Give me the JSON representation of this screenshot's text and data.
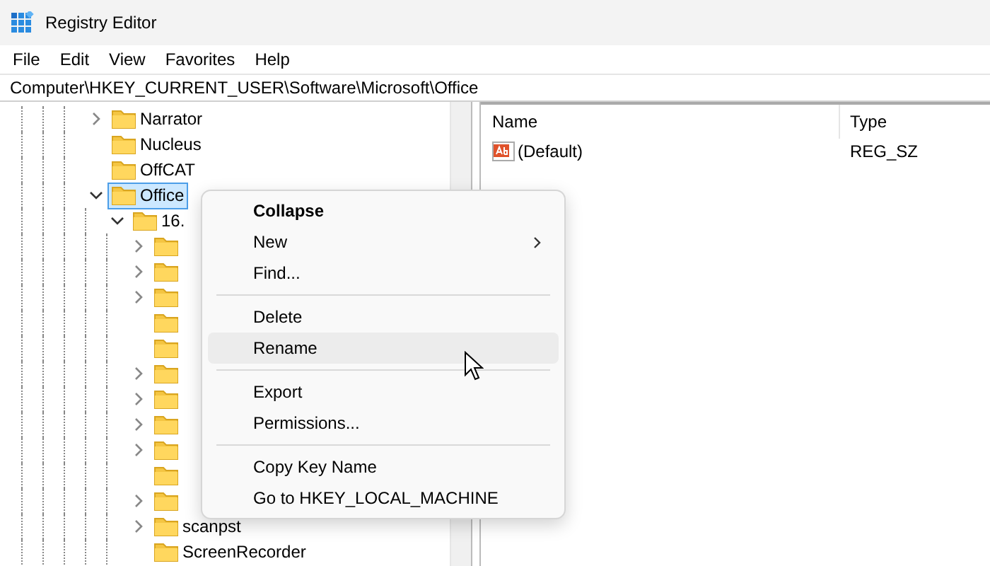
{
  "window": {
    "title": "Registry Editor"
  },
  "menu_bar": [
    "File",
    "Edit",
    "View",
    "Favorites",
    "Help"
  ],
  "address": "Computer\\HKEY_CURRENT_USER\\Software\\Microsoft\\Office",
  "tree": [
    {
      "label": "Narrator",
      "expandable": true,
      "expanded": false,
      "selected": false
    },
    {
      "label": "Nucleus",
      "expandable": false,
      "selected": false
    },
    {
      "label": "OffCAT",
      "expandable": false,
      "selected": false
    },
    {
      "label": "Office",
      "expandable": true,
      "expanded": true,
      "selected": true,
      "children": [
        {
          "label": "16.",
          "expandable": true,
          "expanded": true,
          "selected": false,
          "children": [
            {
              "expandable": true,
              "expanded": false,
              "selected": false
            },
            {
              "expandable": true,
              "expanded": false,
              "selected": false
            },
            {
              "expandable": true,
              "expanded": false,
              "selected": false
            },
            {
              "expandable": false,
              "selected": false
            },
            {
              "expandable": false,
              "selected": false
            },
            {
              "expandable": true,
              "expanded": false,
              "selected": false
            },
            {
              "expandable": true,
              "expanded": false,
              "selected": false
            },
            {
              "expandable": true,
              "expanded": false,
              "selected": false
            },
            {
              "expandable": true,
              "expanded": false,
              "selected": false
            },
            {
              "expandable": false,
              "selected": false
            },
            {
              "expandable": true,
              "expanded": false,
              "selected": false
            },
            {
              "label": "scanpst",
              "expandable": true,
              "expanded": false,
              "selected": false
            },
            {
              "label": "ScreenRecorder",
              "expandable": false,
              "selected": false
            }
          ]
        }
      ]
    }
  ],
  "values_table": {
    "columns": [
      "Name",
      "Type"
    ],
    "rows": [
      {
        "name": "(Default)",
        "type": "REG_SZ"
      }
    ]
  },
  "context_menu": [
    {
      "kind": "item",
      "label": "Collapse",
      "bold": true,
      "submenu": false,
      "selected": false
    },
    {
      "kind": "item",
      "label": "New",
      "bold": false,
      "submenu": true,
      "selected": false
    },
    {
      "kind": "item",
      "label": "Find...",
      "bold": false,
      "submenu": false,
      "selected": false
    },
    {
      "kind": "separator"
    },
    {
      "kind": "item",
      "label": "Delete",
      "bold": false,
      "submenu": false,
      "selected": false
    },
    {
      "kind": "item",
      "label": "Rename",
      "bold": false,
      "submenu": false,
      "selected": true
    },
    {
      "kind": "separator"
    },
    {
      "kind": "item",
      "label": "Export",
      "bold": false,
      "submenu": false,
      "selected": false
    },
    {
      "kind": "item",
      "label": "Permissions...",
      "bold": false,
      "submenu": false,
      "selected": false
    },
    {
      "kind": "separator"
    },
    {
      "kind": "item",
      "label": "Copy Key Name",
      "bold": false,
      "submenu": false,
      "selected": false
    },
    {
      "kind": "item",
      "label": "Go to HKEY_LOCAL_MACHINE",
      "bold": false,
      "submenu": false,
      "selected": false
    }
  ]
}
